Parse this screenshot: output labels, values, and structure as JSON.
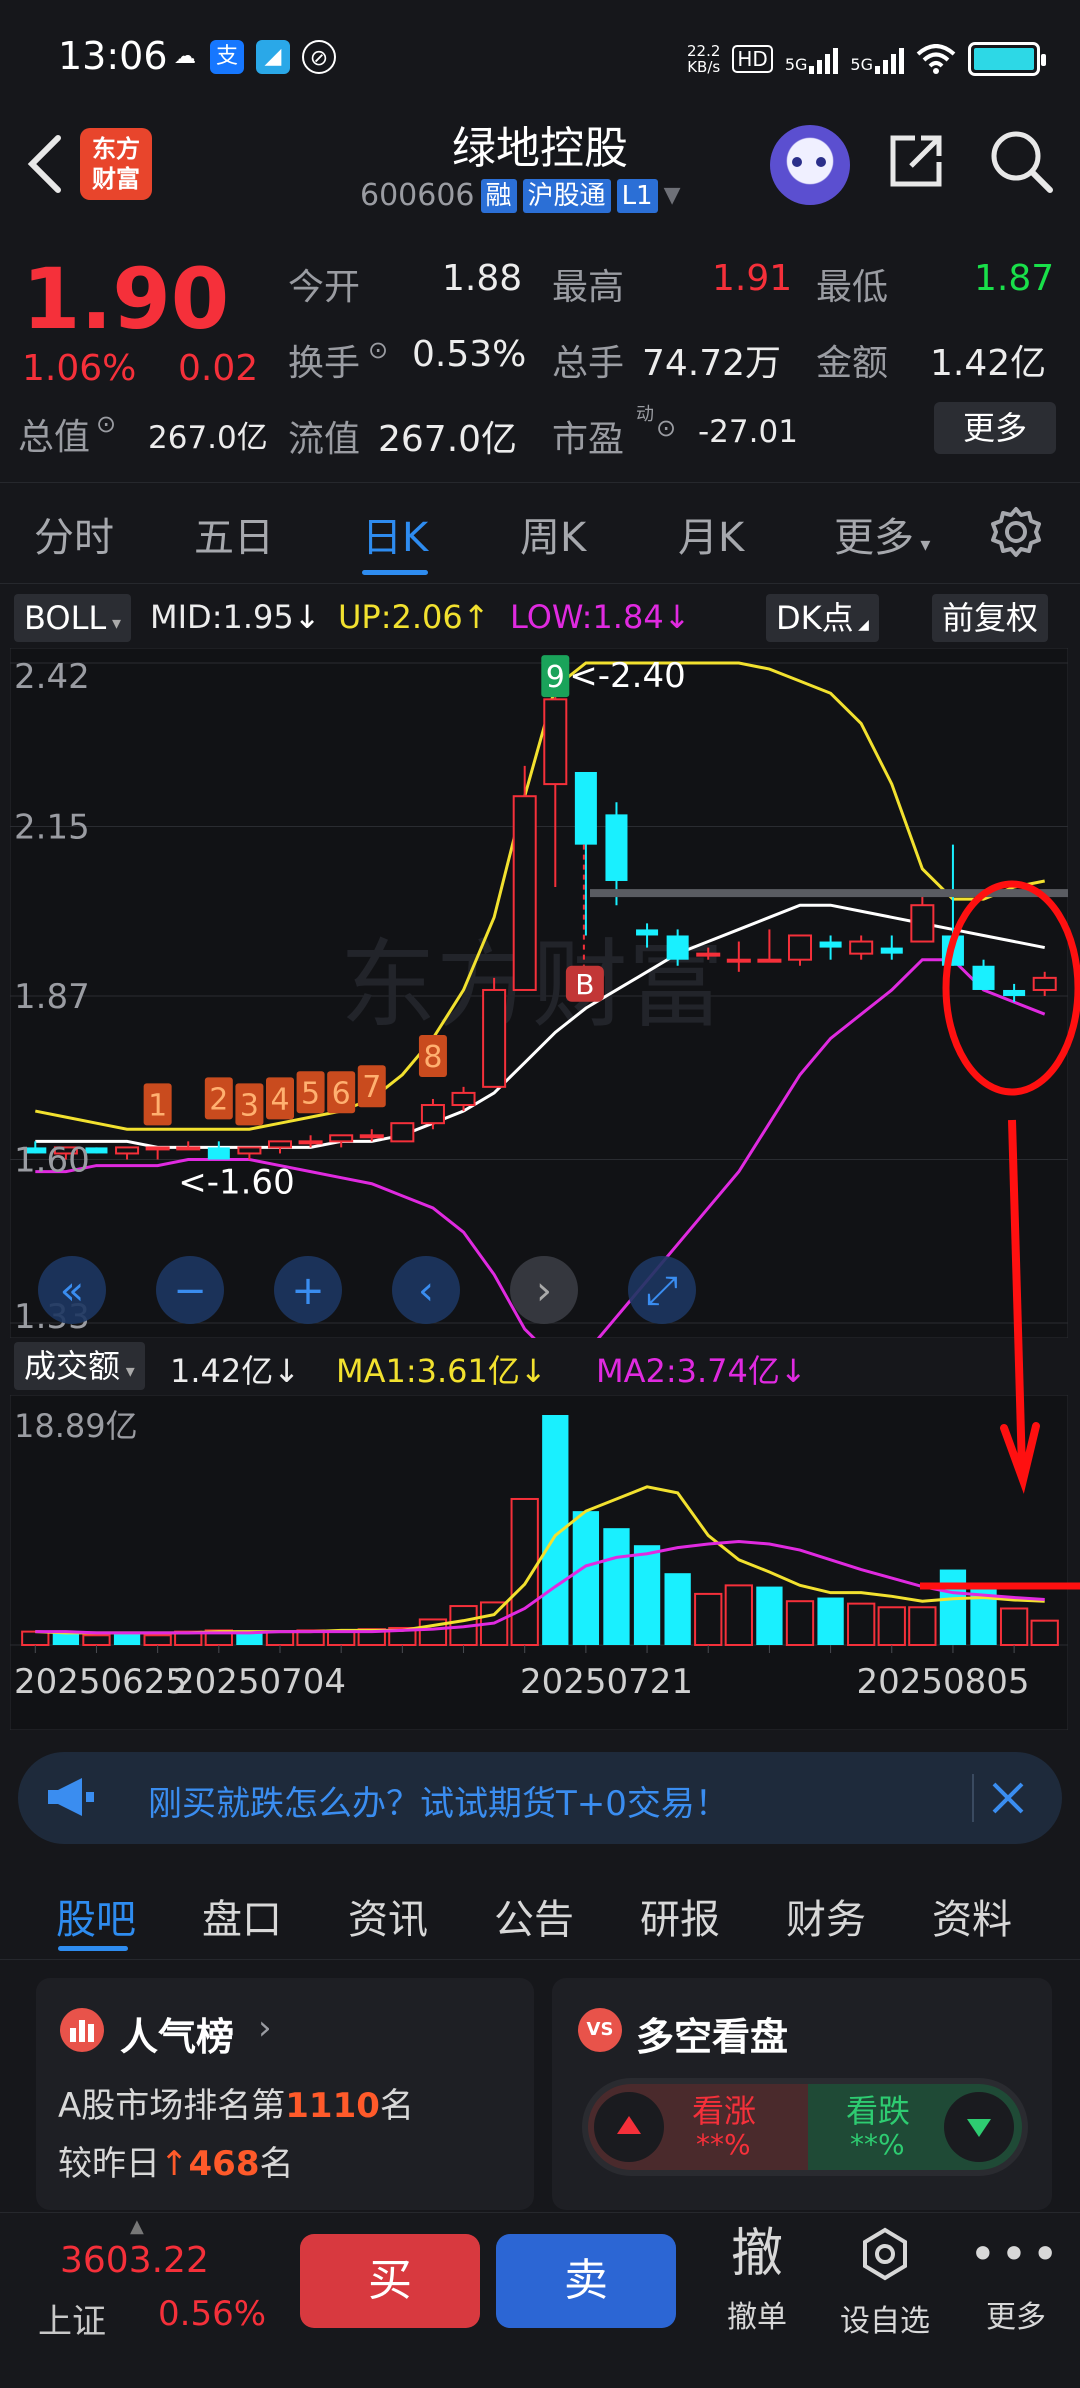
{
  "status_bar": {
    "time": "13:06",
    "net_speed": "22.2\nKB/s",
    "hd": "HD",
    "sig1": "5G",
    "sig2": "5G"
  },
  "header": {
    "logo_text_1": "东方",
    "logo_text_2": "财富",
    "stock_name": "绿地控股",
    "stock_code": "600606",
    "tags": [
      "融",
      "沪股通",
      "L1"
    ]
  },
  "quote": {
    "price": "1.90",
    "change_pct": "1.06%",
    "change": "0.02",
    "open_label": "今开",
    "open": "1.88",
    "high_label": "最高",
    "high": "1.91",
    "low_label": "最低",
    "low": "1.87",
    "turnover_label": "换手",
    "turnover": "0.53%",
    "volume_label": "总手",
    "volume": "74.72万",
    "amount_label": "金额",
    "amount": "1.42亿",
    "mktcap_label": "总值",
    "mktcap": "267.0亿",
    "float_label": "流值",
    "float": "267.0亿",
    "pe_label": "市盈",
    "pe_sup": "动",
    "pe": "-27.01",
    "more": "更多"
  },
  "period_tabs": [
    "分时",
    "五日",
    "日K",
    "周K",
    "月K",
    "更多"
  ],
  "active_tab": "日K",
  "boll": {
    "name": "BOLL",
    "mid": "MID:1.95",
    "up": "UP:2.06",
    "low": "LOW:1.84",
    "dk": "DK点",
    "adjust": "前复权"
  },
  "vol_header": {
    "name": "成交额",
    "value": "1.42亿",
    "ma1": "MA1:3.61亿",
    "ma2": "MA2:3.74亿"
  },
  "chart_data": {
    "type": "candlestick",
    "y_ticks": [
      "2.42",
      "2.15",
      "1.87",
      "1.60",
      "1.33"
    ],
    "ylim": [
      1.33,
      2.42
    ],
    "annotations": [
      "<-2.40",
      "<-1.60",
      "B"
    ],
    "nine_turn_labels": [
      "1",
      "2",
      "3",
      "4",
      "5",
      "6",
      "7",
      "8",
      "9"
    ],
    "candles": [
      {
        "o": 1.62,
        "h": 1.63,
        "l": 1.61,
        "c": 1.61
      },
      {
        "o": 1.61,
        "h": 1.62,
        "l": 1.6,
        "c": 1.62
      },
      {
        "o": 1.62,
        "h": 1.62,
        "l": 1.61,
        "c": 1.61
      },
      {
        "o": 1.61,
        "h": 1.62,
        "l": 1.6,
        "c": 1.62
      },
      {
        "o": 1.62,
        "h": 1.62,
        "l": 1.6,
        "c": 1.62
      },
      {
        "o": 1.62,
        "h": 1.63,
        "l": 1.62,
        "c": 1.62
      },
      {
        "o": 1.62,
        "h": 1.63,
        "l": 1.6,
        "c": 1.6
      },
      {
        "o": 1.61,
        "h": 1.62,
        "l": 1.6,
        "c": 1.62
      },
      {
        "o": 1.62,
        "h": 1.63,
        "l": 1.61,
        "c": 1.63
      },
      {
        "o": 1.63,
        "h": 1.64,
        "l": 1.62,
        "c": 1.63
      },
      {
        "o": 1.63,
        "h": 1.64,
        "l": 1.62,
        "c": 1.64
      },
      {
        "o": 1.64,
        "h": 1.65,
        "l": 1.63,
        "c": 1.64
      },
      {
        "o": 1.63,
        "h": 1.66,
        "l": 1.63,
        "c": 1.66
      },
      {
        "o": 1.66,
        "h": 1.7,
        "l": 1.65,
        "c": 1.69
      },
      {
        "o": 1.69,
        "h": 1.72,
        "l": 1.68,
        "c": 1.71
      },
      {
        "o": 1.72,
        "h": 1.9,
        "l": 1.72,
        "c": 1.88
      },
      {
        "o": 1.88,
        "h": 2.25,
        "l": 1.88,
        "c": 2.2
      },
      {
        "o": 2.22,
        "h": 2.4,
        "l": 2.05,
        "c": 2.36
      },
      {
        "o": 2.24,
        "h": 2.24,
        "l": 1.97,
        "c": 2.12
      },
      {
        "o": 2.17,
        "h": 2.19,
        "l": 2.02,
        "c": 2.06
      },
      {
        "o": 1.98,
        "h": 1.99,
        "l": 1.95,
        "c": 1.97
      },
      {
        "o": 1.97,
        "h": 1.98,
        "l": 1.92,
        "c": 1.93
      },
      {
        "o": 1.94,
        "h": 1.95,
        "l": 1.93,
        "c": 1.94
      },
      {
        "o": 1.93,
        "h": 1.96,
        "l": 1.91,
        "c": 1.93
      },
      {
        "o": 1.93,
        "h": 1.98,
        "l": 1.93,
        "c": 1.93
      },
      {
        "o": 1.93,
        "h": 1.97,
        "l": 1.92,
        "c": 1.97
      },
      {
        "o": 1.96,
        "h": 1.97,
        "l": 1.93,
        "c": 1.95
      },
      {
        "o": 1.94,
        "h": 1.97,
        "l": 1.93,
        "c": 1.96
      },
      {
        "o": 1.95,
        "h": 1.97,
        "l": 1.93,
        "c": 1.94
      },
      {
        "o": 1.96,
        "h": 2.04,
        "l": 1.96,
        "c": 2.02
      },
      {
        "o": 1.97,
        "h": 2.12,
        "l": 1.92,
        "c": 1.92
      },
      {
        "o": 1.92,
        "h": 1.93,
        "l": 1.88,
        "c": 1.88
      },
      {
        "o": 1.88,
        "h": 1.89,
        "l": 1.86,
        "c": 1.87
      },
      {
        "o": 1.88,
        "h": 1.91,
        "l": 1.87,
        "c": 1.9
      }
    ],
    "boll_up": [
      1.68,
      1.67,
      1.66,
      1.65,
      1.65,
      1.65,
      1.65,
      1.65,
      1.66,
      1.67,
      1.68,
      1.7,
      1.74,
      1.8,
      1.88,
      2.0,
      2.2,
      2.38,
      2.42,
      2.42,
      2.42,
      2.42,
      2.42,
      2.42,
      2.41,
      2.39,
      2.37,
      2.32,
      2.22,
      2.08,
      2.03,
      2.03,
      2.05,
      2.06
    ],
    "boll_mid": [
      1.63,
      1.63,
      1.63,
      1.63,
      1.62,
      1.62,
      1.62,
      1.62,
      1.62,
      1.62,
      1.63,
      1.63,
      1.64,
      1.66,
      1.68,
      1.71,
      1.76,
      1.81,
      1.85,
      1.88,
      1.91,
      1.94,
      1.96,
      1.98,
      2.0,
      2.02,
      2.02,
      2.01,
      2.0,
      1.99,
      1.98,
      1.97,
      1.96,
      1.95
    ],
    "boll_low": [
      1.58,
      1.58,
      1.59,
      1.59,
      1.59,
      1.6,
      1.6,
      1.6,
      1.59,
      1.58,
      1.57,
      1.56,
      1.54,
      1.52,
      1.48,
      1.41,
      1.32,
      1.27,
      1.28,
      1.34,
      1.4,
      1.46,
      1.52,
      1.58,
      1.66,
      1.74,
      1.8,
      1.84,
      1.88,
      1.93,
      1.93,
      1.88,
      1.86,
      1.84
    ],
    "volume_axis_max": "18.89亿",
    "volume": [
      1.1,
      1.1,
      0.8,
      1.0,
      0.8,
      1.1,
      1.2,
      1.2,
      1.1,
      1.2,
      1.1,
      1.3,
      1.4,
      2.1,
      3.2,
      3.5,
      12.0,
      18.9,
      11.0,
      9.6,
      8.2,
      5.9,
      4.2,
      4.9,
      4.8,
      3.6,
      3.9,
      3.4,
      3.1,
      3.1,
      6.2,
      4.7,
      3.0,
      2.0
    ],
    "volume_up": [
      true,
      false,
      true,
      false,
      true,
      true,
      true,
      false,
      true,
      true,
      true,
      true,
      true,
      true,
      true,
      true,
      true,
      false,
      false,
      false,
      false,
      false,
      true,
      true,
      false,
      true,
      false,
      true,
      true,
      true,
      false,
      false,
      true,
      true
    ],
    "vol_ma1": [
      1.1,
      1.0,
      1.0,
      1.0,
      1.0,
      1.0,
      1.1,
      1.1,
      1.1,
      1.1,
      1.2,
      1.2,
      1.2,
      1.6,
      2.0,
      2.5,
      5.0,
      9.0,
      11.0,
      12.0,
      13.0,
      12.5,
      9.0,
      7.0,
      6.0,
      4.9,
      4.3,
      4.3,
      4.0,
      3.6,
      3.8,
      3.9,
      3.7,
      3.6
    ],
    "vol_ma2": [
      1.1,
      1.1,
      1.0,
      1.0,
      1.0,
      1.0,
      1.0,
      1.0,
      1.1,
      1.1,
      1.1,
      1.1,
      1.2,
      1.3,
      1.5,
      1.8,
      3.0,
      4.8,
      6.5,
      7.2,
      7.5,
      8.0,
      8.3,
      8.5,
      8.3,
      7.8,
      7.0,
      6.2,
      5.5,
      4.8,
      4.3,
      4.1,
      3.9,
      3.74
    ],
    "x_labels": [
      {
        "i": 0,
        "text": "20250625"
      },
      {
        "i": 5,
        "text": "20250704"
      },
      {
        "i": 17,
        "text": "20250721"
      },
      {
        "i": 28,
        "text": "20250805"
      }
    ]
  },
  "chart_controls": [
    "«",
    "−",
    "+",
    "‹",
    "›",
    "⤢"
  ],
  "ad": {
    "text": "刚买就跌怎么办？试试期货T+0交易！"
  },
  "bottom_tabs": [
    "股吧",
    "盘口",
    "资讯",
    "公告",
    "研报",
    "财务",
    "资料"
  ],
  "cards": {
    "popularity_title": "人气榜",
    "rank_prefix": "A股市场排名第",
    "rank": "1110",
    "rank_suffix": "名",
    "change_prefix": "较昨日",
    "change_value": "468",
    "change_suffix": "名",
    "duokong_title": "多空看盘",
    "bull_label": "看涨",
    "bull_value": "**%",
    "bear_label": "看跌",
    "bear_value": "**%"
  },
  "footer": {
    "index_value": "3603.22",
    "index_name": "上证",
    "index_change": "0.56%",
    "buy": "买",
    "sell": "卖",
    "cancel_glyph": "撤",
    "cancel_label": "撤单",
    "watch_label": "设自选",
    "more_label": "更多"
  },
  "colors": {
    "up": "#f5303a",
    "down": "#19f0ff",
    "boll_up": "#f2e12f",
    "boll_mid": "#ffffff",
    "boll_low": "#e02ae0",
    "accent": "#2e8cf0"
  }
}
